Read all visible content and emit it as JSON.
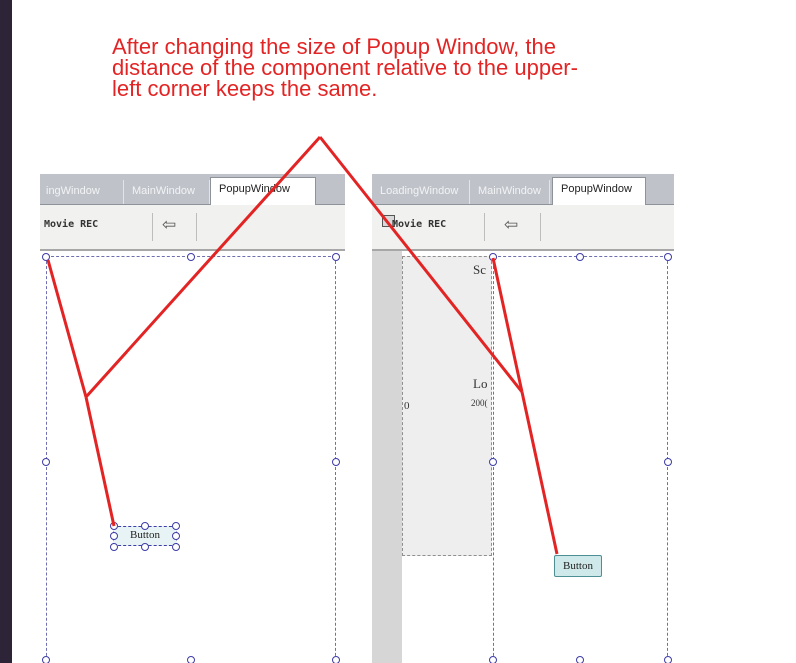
{
  "caption": {
    "line1": "After changing the size of Popup Window, the",
    "line2": "distance of the component relative to the upper-",
    "line3": "left corner keeps the same."
  },
  "left_panel": {
    "tabs": [
      "ingWindow",
      "MainWindow",
      "PopupWindow"
    ],
    "toolbar_label": "Movie REC",
    "back_arrow": "⇦",
    "button_label": "Button"
  },
  "right_panel": {
    "tabs": [
      "LoadingWindow",
      "MainWindow",
      "PopupWindow"
    ],
    "toolbar_label": "Movie REC",
    "back_arrow": "⇦",
    "button_label": "Button",
    "behind_text": [
      "Sc",
      "Lo",
      "200(",
      "0"
    ]
  },
  "colors": {
    "annotation_red": "#e32424",
    "slide_background": "#2e2438",
    "tab_bar": "#bfc3c9",
    "handle": "#3c3ca8"
  }
}
